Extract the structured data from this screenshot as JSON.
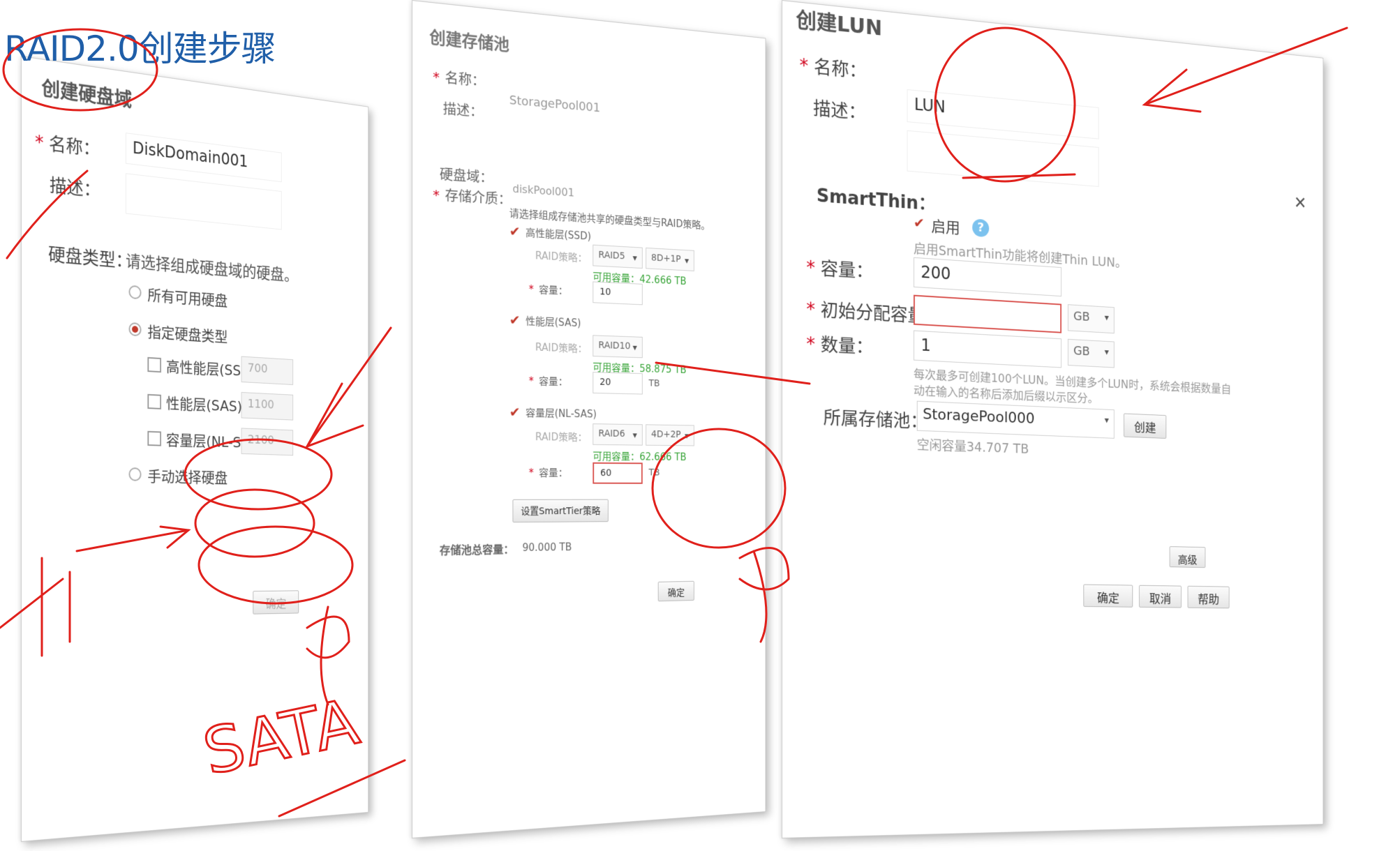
{
  "slide": {
    "title": "RAID2.0创建步骤"
  },
  "disk_domain": {
    "title": "创建硬盘域",
    "name_label": "名称：",
    "desc_label": "描述：",
    "name_value": "DiskDomain001",
    "disk_type_label": "硬盘类型：",
    "disk_type_hint": "请选择组成硬盘域的硬盘。",
    "radio_all": "所有可用硬盘",
    "radio_specify": "指定硬盘类型",
    "tier_ssd": "高性能层(SSD)",
    "tier_sas": "性能层(SAS)",
    "tier_nlsas": "容量层(NL-SAS)",
    "ssd_count": "700",
    "sas_count": "1100",
    "nlsas_count": "2100",
    "radio_manual": "手动选择硬盘",
    "ok": "确定"
  },
  "storage_pool": {
    "title": "创建存储池",
    "name_label": "名称：",
    "desc_label": "描述：",
    "name_value": "StoragePool001",
    "domain_label": "硬盘域：",
    "domain_value": "diskPool001",
    "medium_label": "存储介质：",
    "medium_hint": "请选择组成存储池共享的硬盘类型与RAID策略。",
    "ssd_tier": "高性能层(SSD)",
    "sas_tier": "性能层(SAS)",
    "nlsas_tier": "容量层(NL-SAS)",
    "raid_label": "RAID策略：",
    "cap_label": "容量：",
    "ssd_raid": "RAID5",
    "ssd_layout": "8D+1P",
    "ssd_avail": "可用容量：42.666 TB",
    "ssd_cap": "10",
    "sas_raid": "RAID10",
    "sas_avail": "可用容量：58.875 TB",
    "sas_cap": "20",
    "nlsas_raid": "RAID6",
    "nlsas_layout": "4D+2P",
    "nlsas_avail": "可用容量：62.666 TB",
    "nlsas_cap": "60",
    "unit_tb": "TB",
    "smarttier_btn": "设置SmartTier策略",
    "total_label": "存储池总容量：",
    "total_value": "90.000 TB",
    "ok": "确定"
  },
  "lun": {
    "title": "创建LUN",
    "name_label": "名称：",
    "desc_label": "描述：",
    "name_value": "LUN",
    "smartthin_label": "SmartThin：",
    "enable_label": "启用",
    "smartthin_hint": "启用SmartThin功能将创建Thin LUN。",
    "capacity_label": "容量：",
    "capacity_value": "200",
    "initial_label": "初始分配容量：",
    "count_label": "数量：",
    "count_value": "1",
    "unit_gb": "GB",
    "count_hint": "每次最多可创建100个LUN。当创建多个LUN时，系统会根据数量自动在输入的名称后添加后缀以示区分。",
    "pool_label": "所属存储池：",
    "pool_value": "StoragePool000",
    "pool_free": "空闲容量34.707 TB",
    "create_btn": "创建",
    "advanced_btn": "高级",
    "ok_btn": "确定",
    "cancel_btn": "取消",
    "help_btn": "帮助",
    "close_icon": "close-icon"
  },
  "annotations": {
    "handwriting": "SATA",
    "colors": {
      "ink": "#e0201b",
      "title": "#1f5ea8"
    }
  }
}
